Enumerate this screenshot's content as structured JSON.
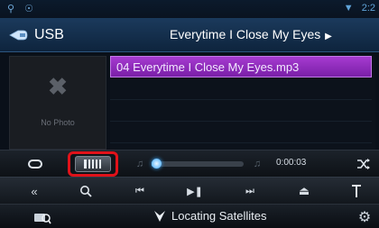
{
  "header": {
    "source_label": "USB",
    "track_title": "Everytime I Close My Eyes"
  },
  "artwork": {
    "placeholder_text": "No Photo"
  },
  "file_list": {
    "selected_item": "04 Everytime I Close My Eyes.mp3"
  },
  "playback": {
    "elapsed_time": "0:00:03",
    "progress_fraction": 0.04
  },
  "status": {
    "nav_text": "Locating Satellites",
    "clock_partial": "2:2"
  },
  "colors": {
    "accent_blue": "#3fa9ff",
    "selected_purple": "#9a31c8",
    "highlight_red": "#e0121a",
    "header_blue": "#1b3a5c"
  },
  "icons": {
    "source": "usb-icon",
    "repeat": "repeat-icon",
    "list": "list-icon",
    "shuffle": "shuffle-icon",
    "back": "back-icon",
    "search": "search-icon",
    "prev": "previous-track-icon",
    "play_pause": "play-pause-icon",
    "next": "next-track-icon",
    "eject": "eject-icon",
    "antenna": "antenna-icon",
    "nav": "navigation-icon",
    "settings": "gear-icon"
  }
}
